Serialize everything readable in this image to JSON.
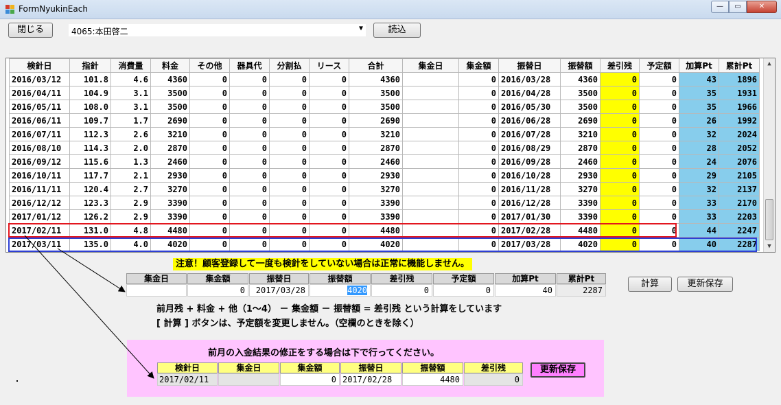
{
  "window": {
    "title": "FormNyukinEach",
    "min_glyph": "—",
    "max_glyph": "▭",
    "close_glyph": "✕"
  },
  "toolbar": {
    "close_label": "閉じる",
    "customer_value": "4065:本田啓二",
    "load_label": "読込"
  },
  "grid": {
    "columns": [
      "検針日",
      "指針",
      "消費量",
      "料金",
      "その他",
      "器具代",
      "分割払",
      "リース",
      "合計",
      "集金日",
      "集金額",
      "振替日",
      "振替額",
      "差引残",
      "予定額",
      "加算Pt",
      "累計Pt"
    ],
    "rows": [
      [
        "2016/03/12",
        "101.8",
        "4.6",
        "4360",
        "0",
        "0",
        "0",
        "0",
        "4360",
        "",
        "0",
        "2016/03/28",
        "4360",
        "0",
        "0",
        "43",
        "1896"
      ],
      [
        "2016/04/11",
        "104.9",
        "3.1",
        "3500",
        "0",
        "0",
        "0",
        "0",
        "3500",
        "",
        "0",
        "2016/04/28",
        "3500",
        "0",
        "0",
        "35",
        "1931"
      ],
      [
        "2016/05/11",
        "108.0",
        "3.1",
        "3500",
        "0",
        "0",
        "0",
        "0",
        "3500",
        "",
        "0",
        "2016/05/30",
        "3500",
        "0",
        "0",
        "35",
        "1966"
      ],
      [
        "2016/06/11",
        "109.7",
        "1.7",
        "2690",
        "0",
        "0",
        "0",
        "0",
        "2690",
        "",
        "0",
        "2016/06/28",
        "2690",
        "0",
        "0",
        "26",
        "1992"
      ],
      [
        "2016/07/11",
        "112.3",
        "2.6",
        "3210",
        "0",
        "0",
        "0",
        "0",
        "3210",
        "",
        "0",
        "2016/07/28",
        "3210",
        "0",
        "0",
        "32",
        "2024"
      ],
      [
        "2016/08/10",
        "114.3",
        "2.0",
        "2870",
        "0",
        "0",
        "0",
        "0",
        "2870",
        "",
        "0",
        "2016/08/29",
        "2870",
        "0",
        "0",
        "28",
        "2052"
      ],
      [
        "2016/09/12",
        "115.6",
        "1.3",
        "2460",
        "0",
        "0",
        "0",
        "0",
        "2460",
        "",
        "0",
        "2016/09/28",
        "2460",
        "0",
        "0",
        "24",
        "2076"
      ],
      [
        "2016/10/11",
        "117.7",
        "2.1",
        "2930",
        "0",
        "0",
        "0",
        "0",
        "2930",
        "",
        "0",
        "2016/10/28",
        "2930",
        "0",
        "0",
        "29",
        "2105"
      ],
      [
        "2016/11/11",
        "120.4",
        "2.7",
        "3270",
        "0",
        "0",
        "0",
        "0",
        "3270",
        "",
        "0",
        "2016/11/28",
        "3270",
        "0",
        "0",
        "32",
        "2137"
      ],
      [
        "2016/12/12",
        "123.3",
        "2.9",
        "3390",
        "0",
        "0",
        "0",
        "0",
        "3390",
        "",
        "0",
        "2016/12/28",
        "3390",
        "0",
        "0",
        "33",
        "2170"
      ],
      [
        "2017/01/12",
        "126.2",
        "2.9",
        "3390",
        "0",
        "0",
        "0",
        "0",
        "3390",
        "",
        "0",
        "2017/01/30",
        "3390",
        "0",
        "0",
        "33",
        "2203"
      ],
      [
        "2017/02/11",
        "131.0",
        "4.8",
        "4480",
        "0",
        "0",
        "0",
        "0",
        "4480",
        "",
        "0",
        "2017/02/28",
        "4480",
        "0",
        "0",
        "44",
        "2247"
      ],
      [
        "2017/03/11",
        "135.0",
        "4.0",
        "4020",
        "0",
        "0",
        "0",
        "0",
        "4020",
        "",
        "0",
        "2017/03/28",
        "4020",
        "0",
        "0",
        "40",
        "2287"
      ]
    ],
    "scroll_up": "▲",
    "scroll_down": "▼"
  },
  "warning": "注意！顧客登録して一度も検針をしていない場合は正常に機能しません。",
  "summary": {
    "headers": [
      "集金日",
      "集金額",
      "振替日",
      "振替額",
      "差引残",
      "予定額",
      "加算Pt",
      "累計Pt"
    ],
    "values": [
      "",
      "0",
      "2017/03/28",
      "4020",
      "0",
      "0",
      "40",
      "2287"
    ]
  },
  "actions": {
    "calc_label": "計算",
    "save_label": "更新保存"
  },
  "notes": {
    "formula": "前月残 + 料金 + 他（1～4） － 集金額 － 振替額 = 差引残 という計算をしています",
    "calc_note": "[ 計算 ] ボタンは、予定額を変更しません。（空欄のときを除く）"
  },
  "fix_panel": {
    "title": "前月の入金結果の修正をする場合は下で行ってください。",
    "headers": [
      "検針日",
      "集金日",
      "集金額",
      "振替日",
      "振替額",
      "差引残"
    ],
    "values": [
      "2017/02/11",
      "",
      "0",
      "2017/02/28",
      "4480",
      "0"
    ],
    "save_label": "更新保存"
  },
  "colors": {
    "highlight_yellow": "#ffff00",
    "point_blue": "#87cdec",
    "fix_pink": "#ffc4ff",
    "red_outline": "#e3161e",
    "blue_outline": "#2d3fd4"
  }
}
